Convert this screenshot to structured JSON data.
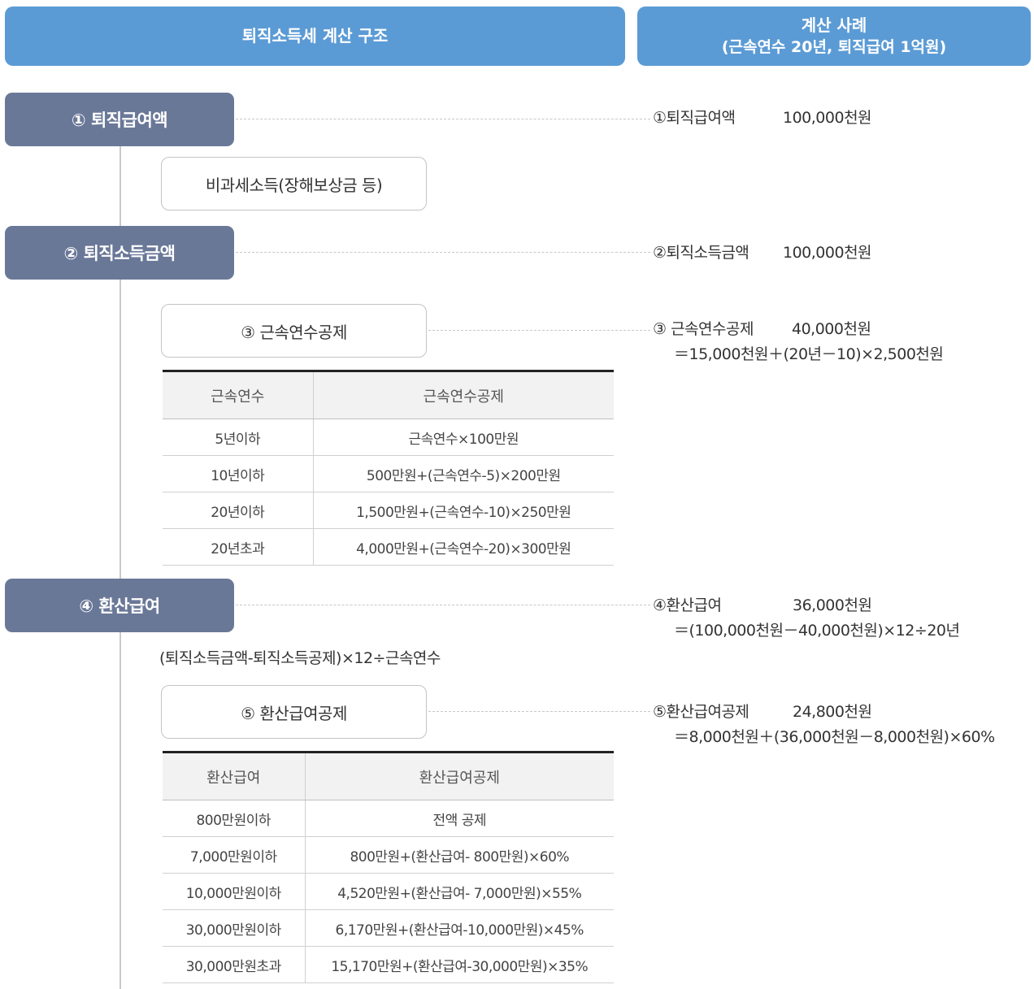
{
  "header": {
    "left_title": "퇴직소득세 계산 구조",
    "right_title": "계산 사례",
    "right_subtitle": "(근속연수 20년, 퇴직급여 1억원)"
  },
  "steps": {
    "s1": "① 퇴직급여액",
    "s2": "② 퇴직소득금액",
    "s4": "④ 환산급여"
  },
  "boxes": {
    "nontax": "비과세소득(장해보상금 등)",
    "s3": "③ 근속연수공제",
    "s5": "⑤ 환산급여공제"
  },
  "note": "(퇴직소득금액-퇴직소득공제)×12÷근속연수",
  "examples": {
    "e1": {
      "label": "①퇴직급여액",
      "amount": "100,000천원"
    },
    "e2": {
      "label": "②퇴직소득금액",
      "amount": "100,000천원"
    },
    "e3": {
      "label": "③ 근속연수공제",
      "amount": "40,000천원",
      "formula": "＝15,000천원＋(20년－10)×2,500천원"
    },
    "e4": {
      "label": "④환산급여",
      "amount": "36,000천원",
      "formula": "＝(100,000천원－40,000천원)×12÷20년"
    },
    "e5": {
      "label": "⑤환산급여공제",
      "amount": "24,800천원",
      "formula": "＝8,000천원＋(36,000천원－8,000천원)×60%"
    }
  },
  "table1": {
    "headers": [
      "근속연수",
      "근속연수공제"
    ],
    "rows": [
      [
        "5년이하",
        "근속연수×100만원"
      ],
      [
        "10년이하",
        "500만원+(근속연수-5)×200만원"
      ],
      [
        "20년이하",
        "1,500만원+(근속연수-10)×250만원"
      ],
      [
        "20년초과",
        "4,000만원+(근속연수-20)×300만원"
      ]
    ]
  },
  "table2": {
    "headers": [
      "환산급여",
      "환산급여공제"
    ],
    "rows": [
      [
        "800만원이하",
        "전액 공제"
      ],
      [
        "7,000만원이하",
        "800만원+(환산급여- 800만원)×60%"
      ],
      [
        "10,000만원이하",
        "4,520만원+(환산급여- 7,000만원)×55%"
      ],
      [
        "30,000만원이하",
        "6,170만원+(환산급여-10,000만원)×45%"
      ],
      [
        "30,000만원초과",
        "15,170만원+(환산급여-30,000만원)×35%"
      ]
    ]
  }
}
